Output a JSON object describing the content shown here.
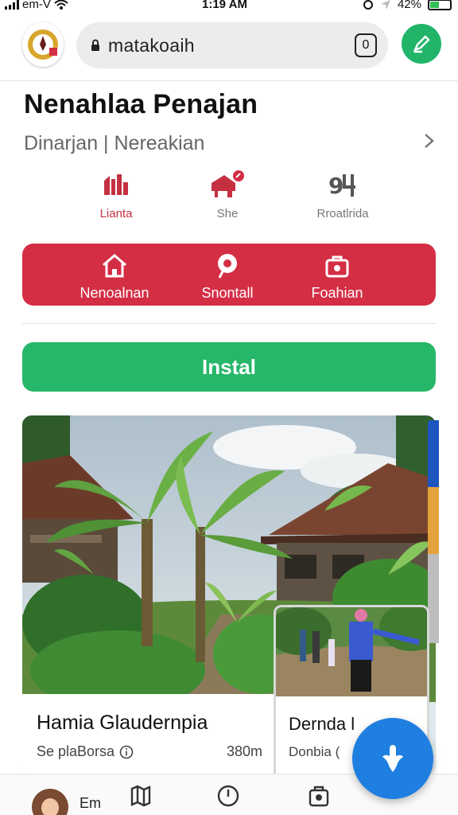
{
  "status_bar": {
    "carrier": "em-V",
    "time": "1:19 AM",
    "battery": "42%"
  },
  "browser": {
    "url": "matakoaih",
    "tab_count": "0"
  },
  "page": {
    "title": "Nenahlaa Penajan",
    "subtitle": "Dinarjan | Nereakian"
  },
  "quick_links": [
    {
      "label": "Lianta",
      "icon": "building-icon"
    },
    {
      "label": "She",
      "icon": "home-pin-icon"
    },
    {
      "label": "Rroatlrida",
      "icon": "number-icon"
    }
  ],
  "action_bar": {
    "items": [
      {
        "label": "Nenoalnan",
        "icon": "home-icon"
      },
      {
        "label": "Snontall",
        "icon": "location-icon"
      },
      {
        "label": "Foahian",
        "icon": "bag-icon"
      }
    ]
  },
  "install_label": "Instal",
  "card": {
    "title": "Hamia Glaudernpia",
    "meta": "Se plaBorsa",
    "distance": "380m"
  },
  "side_card": {
    "title": "Dernda l",
    "meta": "Donbia ("
  },
  "bottom_nav": {
    "label": "Em"
  },
  "colors": {
    "accent_red": "#d42e45",
    "accent_green": "#27b76a",
    "fab_blue": "#1f7fe0"
  }
}
